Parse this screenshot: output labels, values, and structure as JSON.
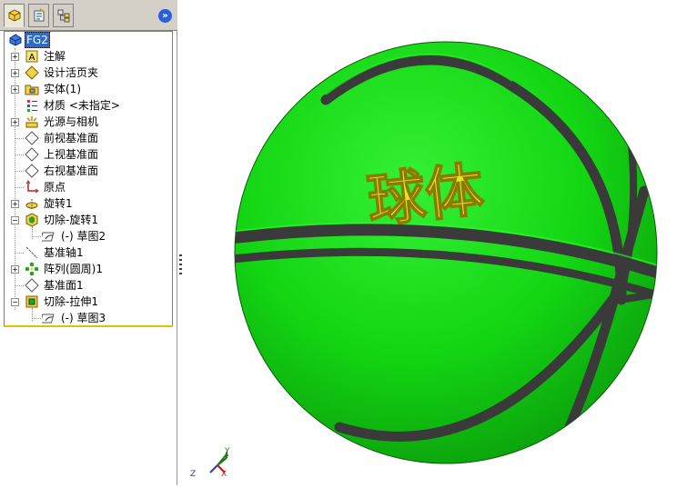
{
  "tabs": [
    {
      "name": "feature-manager",
      "active": true
    },
    {
      "name": "property-manager",
      "active": false
    },
    {
      "name": "configuration-manager",
      "active": false
    }
  ],
  "collapse_glyph": "»",
  "tree": {
    "root": "FG2",
    "items": [
      {
        "label": "注解",
        "icon": "annotations-icon"
      },
      {
        "label": "设计活页夹",
        "icon": "design-binder-icon"
      },
      {
        "label": "实体(1)",
        "icon": "solid-bodies-icon"
      },
      {
        "label": "材质 <未指定>",
        "icon": "material-icon"
      },
      {
        "label": "光源与相机",
        "icon": "lights-cameras-icon"
      },
      {
        "label": "前视基准面",
        "icon": "plane-icon"
      },
      {
        "label": "上视基准面",
        "icon": "plane-icon"
      },
      {
        "label": "右视基准面",
        "icon": "plane-icon"
      },
      {
        "label": "原点",
        "icon": "origin-icon"
      },
      {
        "label": "旋转1",
        "icon": "revolve-icon"
      },
      {
        "label": "切除-旋转1",
        "icon": "cut-revolve-icon"
      },
      {
        "label": "(-) 草图2",
        "icon": "sketch-icon"
      },
      {
        "label": "基准轴1",
        "icon": "axis-icon"
      },
      {
        "label": "阵列(圆周)1",
        "icon": "circular-pattern-icon"
      },
      {
        "label": "基准面1",
        "icon": "plane-icon"
      },
      {
        "label": "切除-拉伸1",
        "icon": "cut-extrude-icon"
      },
      {
        "label": "(-) 草图3",
        "icon": "sketch-icon"
      }
    ]
  },
  "model": {
    "emboss_text": "球体",
    "ball_color": "#13e313",
    "seam_color": "#3a3a3a",
    "text_color": "#e6e41c"
  },
  "triad": {
    "x": "X",
    "y": "Y",
    "z": "Z"
  }
}
